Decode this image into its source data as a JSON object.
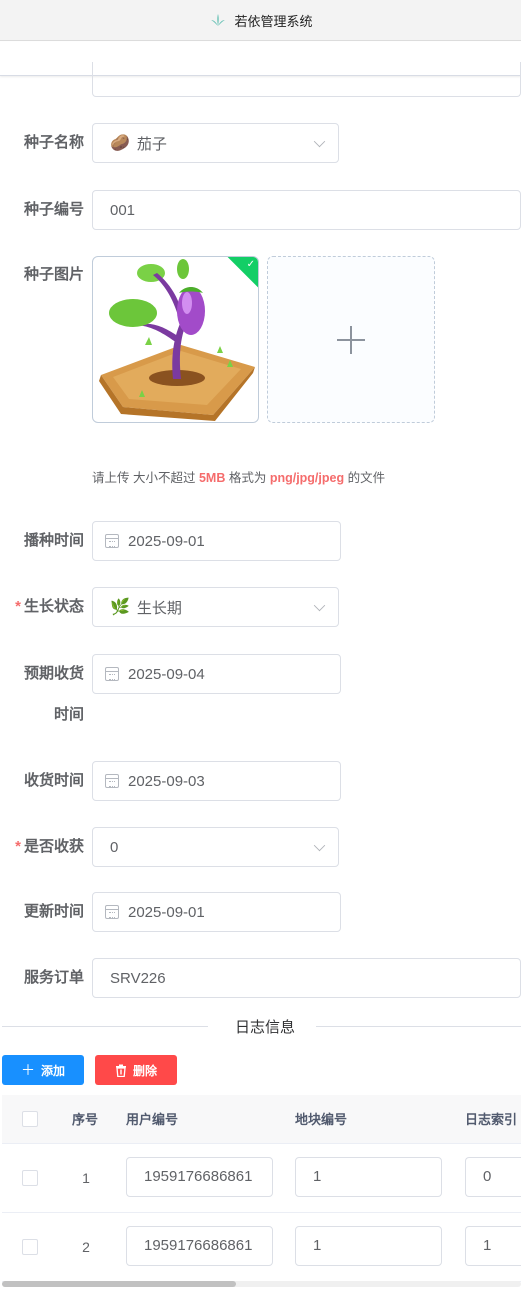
{
  "app": {
    "title": "若依管理系统"
  },
  "form": {
    "partial_label": "地块编号",
    "seed_name": {
      "label": "种子名称",
      "emoji": "🥔",
      "value": "茄子"
    },
    "seed_code": {
      "label": "种子编号",
      "value": "001"
    },
    "seed_image": {
      "label": "种子图片"
    },
    "upload_tip": {
      "prefix": "请上传 大小不超过 ",
      "size": "5MB",
      "middle": " 格式为 ",
      "formats": "png/jpg/jpeg",
      "suffix": " 的文件"
    },
    "sow_time": {
      "label": "播种时间",
      "value": "2025-09-01"
    },
    "growth_status": {
      "label": "生长状态",
      "required": "*",
      "emoji": "🌿",
      "value": "生长期"
    },
    "expected_harvest": {
      "label_line1": "预期收货",
      "label_line2": "时间",
      "value": "2025-09-04"
    },
    "harvest_time": {
      "label": "收货时间",
      "value": "2025-09-03"
    },
    "is_harvested": {
      "label": "是否收获",
      "required": "*",
      "value": "0"
    },
    "update_time": {
      "label": "更新时间",
      "value": "2025-09-01"
    },
    "service_order": {
      "label": "服务订单",
      "value": "SRV226"
    }
  },
  "log_section": {
    "title": "日志信息",
    "add_button": "添加",
    "delete_button": "删除",
    "columns": [
      "序号",
      "用户编号",
      "地块编号",
      "日志索引"
    ],
    "rows": [
      {
        "index": "1",
        "user_id": "1959176686861",
        "plot_id": "1",
        "log_index": "0"
      },
      {
        "index": "2",
        "user_id": "1959176686861",
        "plot_id": "1",
        "log_index": "1"
      }
    ]
  },
  "colors": {
    "primary": "#1890ff",
    "danger": "#ff4949",
    "required": "#f56c6c",
    "success": "#13ce66"
  }
}
